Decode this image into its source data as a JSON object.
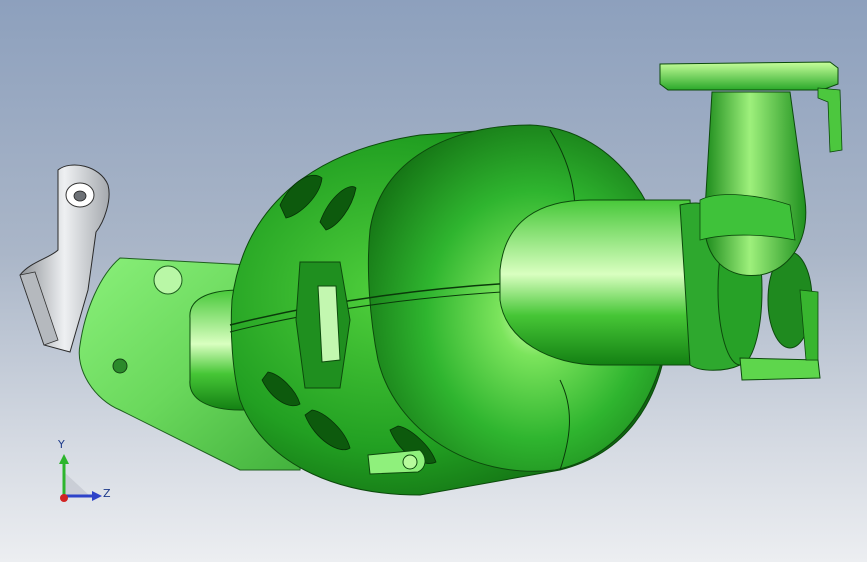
{
  "viewport": {
    "view_triad": {
      "y_label": "Y",
      "z_label": "Z"
    }
  },
  "colors": {
    "model_primary": "#2fb52f",
    "model_highlight": "#b6f58c",
    "model_shadow": "#0f6a10",
    "bracket_metal": "#c9ccd0",
    "background_top": "#8da0bd",
    "background_bottom": "#eceef1",
    "axis_y": "#2db52d",
    "axis_z": "#2d42c9",
    "axis_x": "#d12323"
  },
  "icons": [
    "view-triad-icon"
  ]
}
